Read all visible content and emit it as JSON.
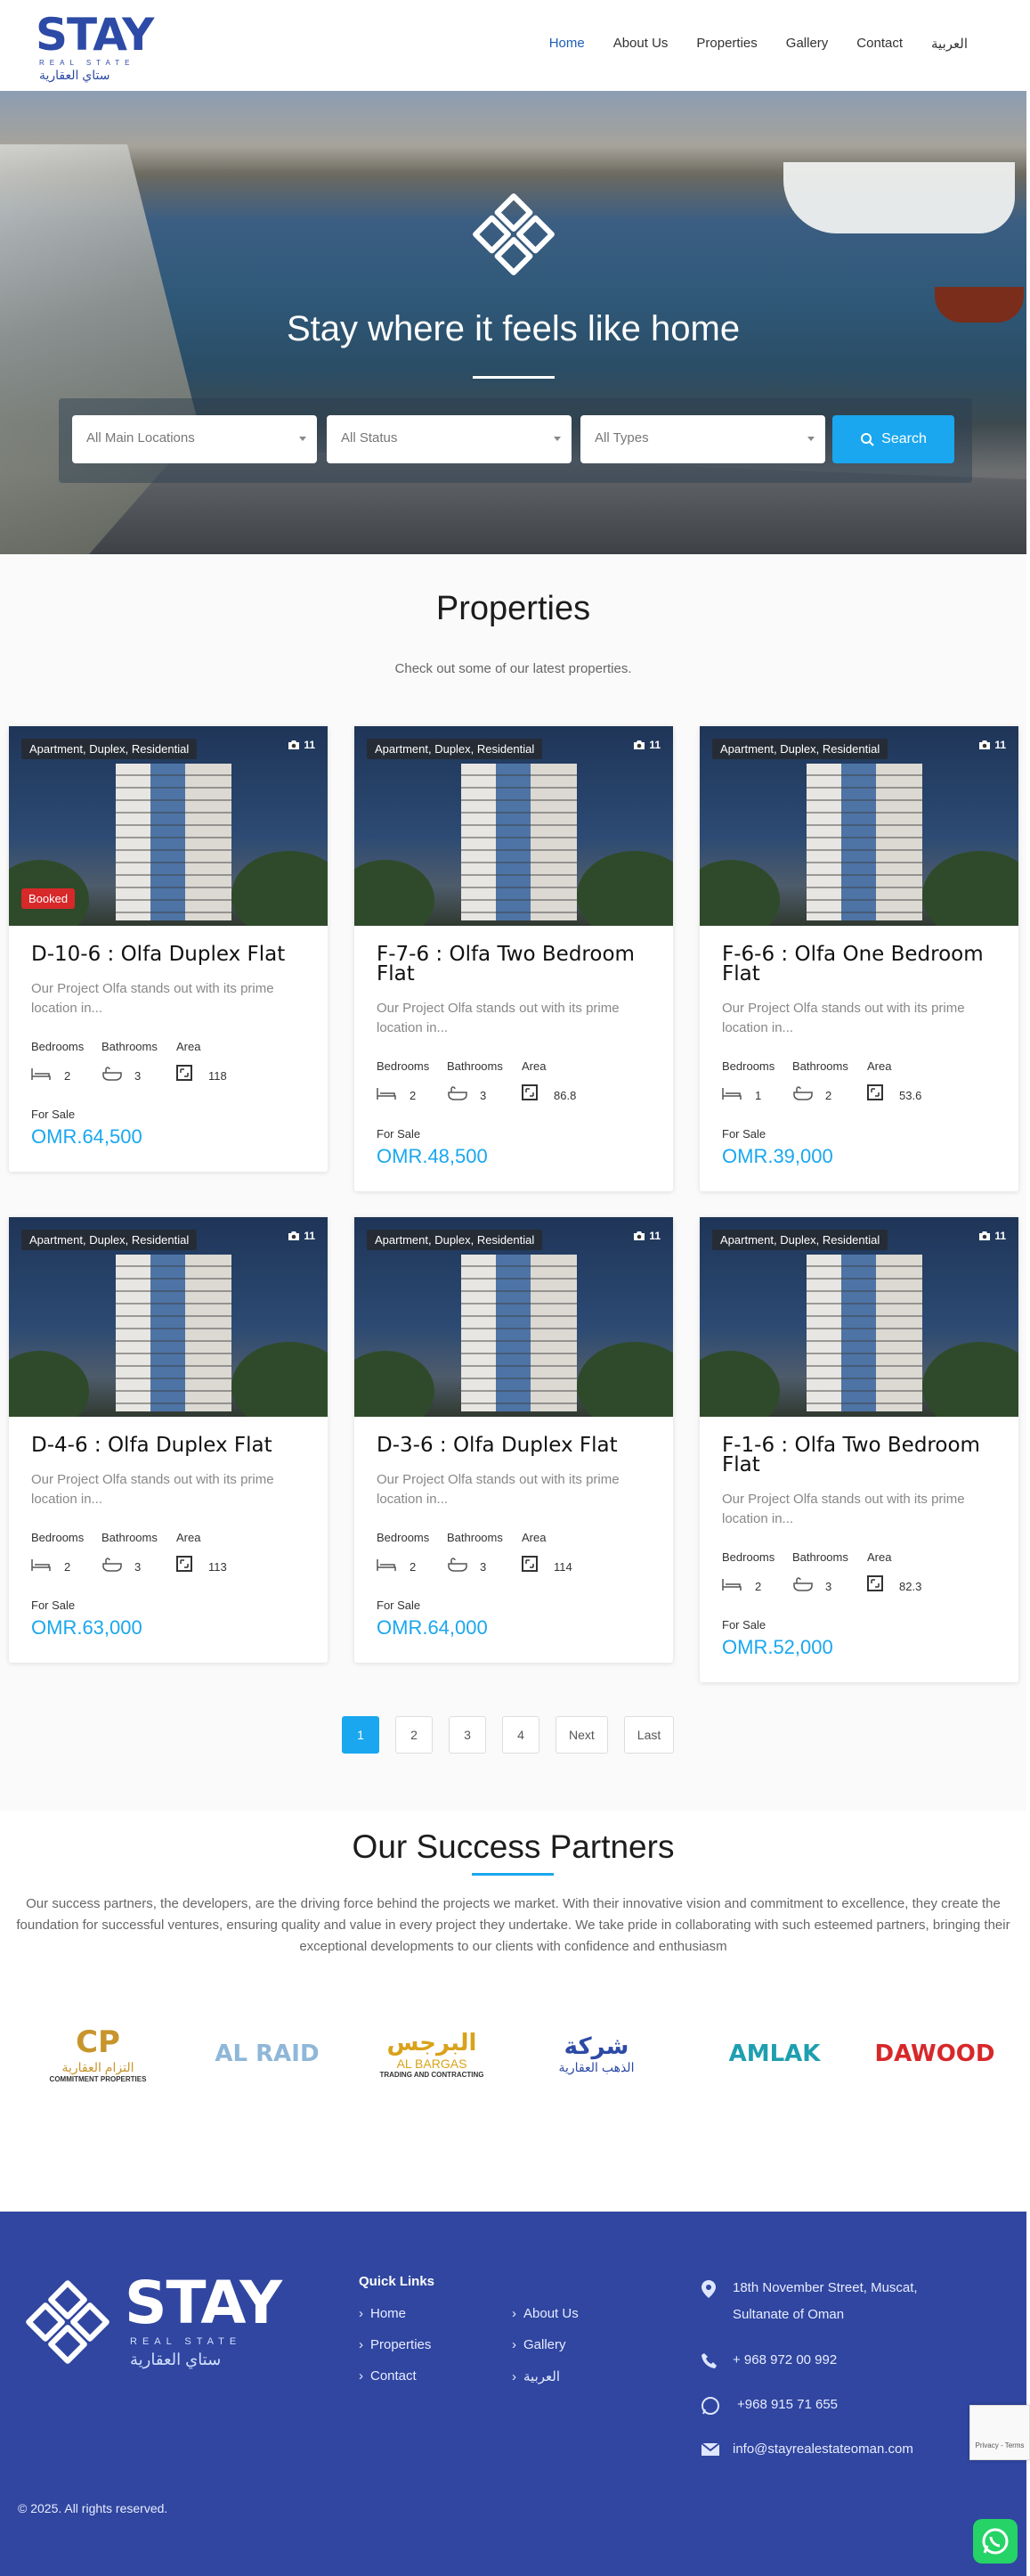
{
  "header": {
    "logo": {
      "word": "STAY",
      "sub": "REAL STATE",
      "arabic": "ستاي العقارية"
    },
    "nav": [
      "Home",
      "About Us",
      "Properties",
      "Gallery",
      "Contact",
      "العربية"
    ]
  },
  "hero": {
    "title": "Stay where it feels like home",
    "search": {
      "location": "All Main Locations",
      "status": "All Status",
      "type": "All Types",
      "button": "Search"
    }
  },
  "properties": {
    "title": "Properties",
    "subtitle": "Check out some of our latest properties.",
    "labels": {
      "bedrooms": "Bedrooms",
      "bathrooms": "Bathrooms",
      "area": "Area"
    },
    "items": [
      {
        "tag": "Apartment, Duplex, Residential",
        "photos": "11",
        "badge": "Booked",
        "title": "D-10-6 : Olfa Duplex Flat",
        "desc": "Our Project Olfa stands out with its prime location in...",
        "bedrooms": "2",
        "bathrooms": "3",
        "area": "118",
        "status": "For Sale",
        "price": "OMR.64,500"
      },
      {
        "tag": "Apartment, Duplex, Residential",
        "photos": "11",
        "badge": "",
        "title": "F-7-6 : Olfa Two Bedroom Flat",
        "desc": "Our Project Olfa stands out with its prime location in...",
        "bedrooms": "2",
        "bathrooms": "3",
        "area": "86.8",
        "status": "For Sale",
        "price": "OMR.48,500"
      },
      {
        "tag": "Apartment, Duplex, Residential",
        "photos": "11",
        "badge": "",
        "title": "F-6-6 : Olfa One Bedroom Flat",
        "desc": "Our Project Olfa stands out with its prime location in...",
        "bedrooms": "1",
        "bathrooms": "2",
        "area": "53.6",
        "status": "For Sale",
        "price": "OMR.39,000"
      },
      {
        "tag": "Apartment, Duplex, Residential",
        "photos": "11",
        "badge": "",
        "title": "D-4-6 : Olfa Duplex Flat",
        "desc": "Our Project Olfa stands out with its prime location in...",
        "bedrooms": "2",
        "bathrooms": "3",
        "area": "113",
        "status": "For Sale",
        "price": "OMR.63,000"
      },
      {
        "tag": "Apartment, Duplex, Residential",
        "photos": "11",
        "badge": "",
        "title": "D-3-6 : Olfa Duplex Flat",
        "desc": "Our Project Olfa stands out with its prime location in...",
        "bedrooms": "2",
        "bathrooms": "3",
        "area": "114",
        "status": "For Sale",
        "price": "OMR.64,000"
      },
      {
        "tag": "Apartment, Duplex, Residential",
        "photos": "11",
        "badge": "",
        "title": "F-1-6 : Olfa Two Bedroom Flat",
        "desc": "Our Project Olfa stands out with its prime location in...",
        "bedrooms": "2",
        "bathrooms": "3",
        "area": "82.3",
        "status": "For Sale",
        "price": "OMR.52,000"
      }
    ],
    "pagination": [
      "1",
      "2",
      "3",
      "4",
      "Next",
      "Last"
    ]
  },
  "partners": {
    "title": "Our Success Partners",
    "text": "Our success partners, the developers, are the driving force behind the projects we market. With their innovative vision and commitment to excellence, they create the foundation for successful ventures, ensuring quality and value in every project they undertake. We take pride in collaborating with such esteemed partners, bringing their exceptional developments to our clients with confidence and enthusiasm",
    "logos": [
      {
        "main": "CP",
        "caption": "التزام العقارية",
        "sub": "COMMITMENT PROPERTIES",
        "color": "#c8952d"
      },
      {
        "main": "AL RAID",
        "caption": "",
        "sub": "",
        "color": "#8fb7d8"
      },
      {
        "main": "البرجس",
        "caption": "AL BARGAS",
        "sub": "TRADING AND CONTRACTING",
        "color": "#d9a21b"
      },
      {
        "main": "شركة",
        "caption": "الذهب العقارية",
        "sub": "",
        "color": "#2c4aa6"
      },
      {
        "main": "AMLAK",
        "caption": "",
        "sub": "",
        "color": "#1e9fb0"
      },
      {
        "main": "DAWOOD",
        "caption": "",
        "sub": "",
        "color": "#d7282a"
      }
    ]
  },
  "footer": {
    "logo": {
      "word": "STAY",
      "sub": "REAL STATE",
      "arabic": "ستاي العقارية"
    },
    "quick_links_title": "Quick Links",
    "links": [
      "Home",
      "Properties",
      "Contact",
      "About Us",
      "Gallery",
      "العربية"
    ],
    "address": "18th November Street, Muscat, Sultanate of Oman",
    "phone": "+ 968 972 00 992",
    "whatsapp": "+968 915 71 655",
    "email": "info@stayrealestateoman.com",
    "copyright": "© 2025. All rights reserved.",
    "recaptcha": "Privacy - Terms"
  },
  "colors": {
    "brand": "#2c4aa6",
    "accent": "#1aa7ef",
    "footer": "#3046a0",
    "booked": "#d7282a"
  }
}
